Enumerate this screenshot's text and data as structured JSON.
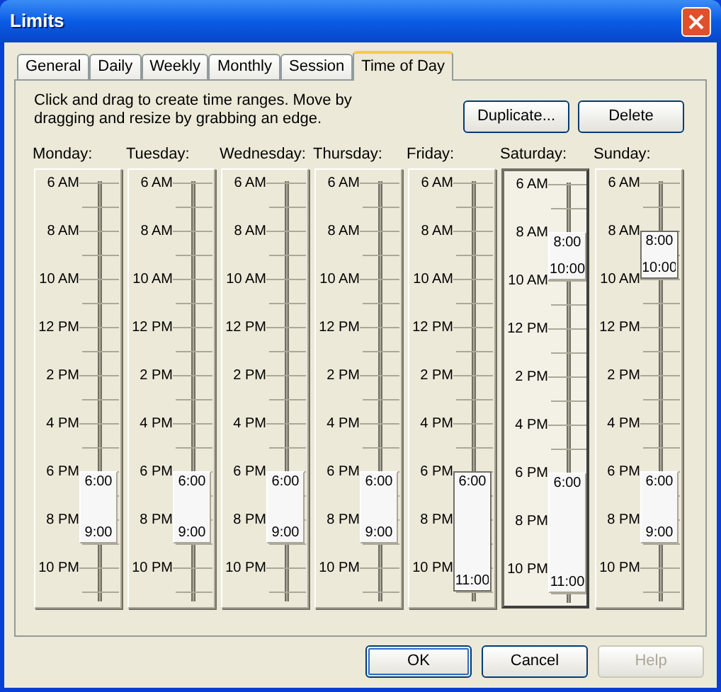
{
  "window": {
    "title": "Limits"
  },
  "tabs": [
    {
      "label": "General",
      "selected": false
    },
    {
      "label": "Daily",
      "selected": false
    },
    {
      "label": "Weekly",
      "selected": false
    },
    {
      "label": "Monthly",
      "selected": false
    },
    {
      "label": "Session",
      "selected": false
    },
    {
      "label": "Time of Day",
      "selected": true
    }
  ],
  "instructions": "Click and drag to create time ranges. Move by dragging and resize by grabbing an edge.",
  "actions": [
    "Duplicate...",
    "Delete"
  ],
  "days": [
    {
      "name": "Monday:",
      "selected": false,
      "hour_labels": [
        "6 AM",
        "8 AM",
        "10 AM",
        "12 PM",
        "2 PM",
        "4 PM",
        "6 PM",
        "8 PM",
        "10 PM"
      ],
      "ranges": [
        {
          "kind": "evening",
          "start": "6:00",
          "end": "9:00",
          "selected": false
        }
      ]
    },
    {
      "name": "Tuesday:",
      "selected": false,
      "hour_labels": [
        "6 AM",
        "8 AM",
        "10 AM",
        "12 PM",
        "2 PM",
        "4 PM",
        "6 PM",
        "8 PM",
        "10 PM"
      ],
      "ranges": [
        {
          "kind": "evening",
          "start": "6:00",
          "end": "9:00",
          "selected": false
        }
      ]
    },
    {
      "name": "Wednesday:",
      "selected": false,
      "hour_labels": [
        "6 AM",
        "8 AM",
        "10 AM",
        "12 PM",
        "2 PM",
        "4 PM",
        "6 PM",
        "8 PM",
        "10 PM"
      ],
      "ranges": [
        {
          "kind": "evening",
          "start": "6:00",
          "end": "9:00",
          "selected": false
        }
      ]
    },
    {
      "name": "Thursday:",
      "selected": false,
      "hour_labels": [
        "6 AM",
        "8 AM",
        "10 AM",
        "12 PM",
        "2 PM",
        "4 PM",
        "6 PM",
        "8 PM",
        "10 PM"
      ],
      "ranges": [
        {
          "kind": "evening",
          "start": "6:00",
          "end": "9:00",
          "selected": false
        }
      ]
    },
    {
      "name": "Friday:",
      "selected": false,
      "hour_labels": [
        "6 AM",
        "8 AM",
        "10 AM",
        "12 PM",
        "2 PM",
        "4 PM",
        "6 PM",
        "8 PM",
        "10 PM"
      ],
      "ranges": [
        {
          "kind": "late",
          "start": "6:00",
          "end": "11:00",
          "selected": true
        }
      ]
    },
    {
      "name": "Saturday:",
      "selected": true,
      "hour_labels": [
        "6 AM",
        "8 AM",
        "10 AM",
        "12 PM",
        "2 PM",
        "4 PM",
        "6 PM",
        "8 PM",
        "10 PM"
      ],
      "ranges": [
        {
          "kind": "morning",
          "start": "8:00",
          "end": "10:00",
          "selected": false
        },
        {
          "kind": "late",
          "start": "6:00",
          "end": "11:00",
          "selected": false
        }
      ]
    },
    {
      "name": "Sunday:",
      "selected": false,
      "hour_labels": [
        "6 AM",
        "8 AM",
        "10 AM",
        "12 PM",
        "2 PM",
        "4 PM",
        "6 PM",
        "8 PM",
        "10 PM"
      ],
      "ranges": [
        {
          "kind": "morning",
          "start": "8:00",
          "end": "10:00",
          "selected": true
        },
        {
          "kind": "evening",
          "start": "6:00",
          "end": "9:00",
          "selected": false
        }
      ]
    }
  ],
  "buttons": [
    {
      "label": "OK",
      "default": true,
      "disabled": false
    },
    {
      "label": "Cancel",
      "default": false,
      "disabled": false
    },
    {
      "label": "Help",
      "default": false,
      "disabled": true
    }
  ]
}
